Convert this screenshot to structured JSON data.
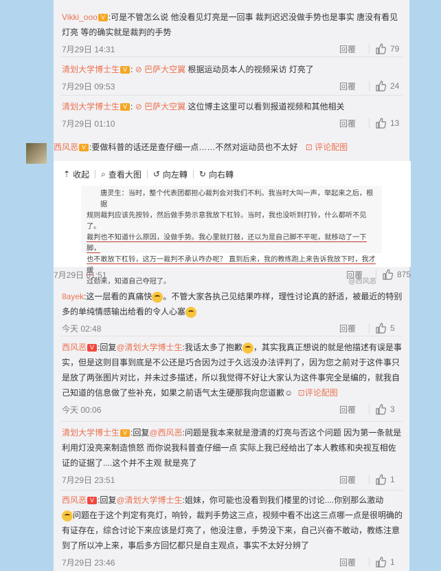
{
  "comments_top": [
    {
      "user": "Vikki_ooo",
      "text": ":可是不管怎么说  他没看见灯亮是一回事  裁判迟迟没做手势也是事实   唐没有看见灯亮  等的确实就是裁判的手势",
      "time": "7月29日 14:31",
      "reply": "回覆",
      "likes": "79"
    },
    {
      "user": "清划大学博士生",
      "link": "巴萨大空翼",
      "text": "根据运动员本人的视频采访 灯亮了",
      "time": "7月29日 09:53",
      "reply": "回覆",
      "likes": "24"
    },
    {
      "user": "清划大学博士生",
      "link": "巴萨大空翼",
      "text": "这位博主这里可以看到报道视频和其他相关",
      "time": "7月29日 01:10",
      "reply": "回覆",
      "likes": "13"
    }
  ],
  "main": {
    "user": "西风恶",
    "text": ":要做科普的话还是查仔细一点……不然对运动员也不太好",
    "pic_link": "评论配图",
    "toolbar": [
      "收起",
      "查看大图",
      "向左轉",
      "向右轉"
    ],
    "quote_lines": [
      "唐灵生：当时，整个代表团都担心裁判会对我们不利。我当时大叫一声，举起来之后，根据",
      "规则裁判应该先按铃，然后做手势示意我放下杠铃。当时，我也没听到打铃，什么都听不见了。",
      "裁判也不知道什么原因，没做手势。我心里就打鼓，还以为是自己脚不平呢，就移动了一下脚，",
      "也不敢放下杠铃，这万一裁判不承认咋办呢？ 直到后来，我的教练跑上来告诉我放下时，我才缓",
      "过劲来，知道自己夺冠了。"
    ],
    "watermark": "@西风恶",
    "time": "7月29日 01:51",
    "reply": "回覆",
    "likes": "875"
  },
  "replies": [
    {
      "user": "8ayek",
      "text": ":这一层看的真痛快",
      "text2": "。不管大家各执己见结果咋样，理性讨论真的舒适，被最近的特别多的单纯情感输出给看的令人心塞",
      "time": "今天 02:48",
      "reply": "回覆",
      "likes": "5"
    },
    {
      "user": "西风恶",
      "prefix": ":回复",
      "mention": "@清划大学博士生",
      "text": ":我话太多了抱歉",
      "text2": "，其实我真正想说的就是他描述有误是事实，但是这则目事到底是不公还是巧合因为过于久远没办法评判了，因为您之前对于这件事只是放了两张图片对比，并未过多描述，所以我觉得不好让大家认为这件事完全是编的，就我自己知道的信息做了些补充，如果之前语气太生硬那我向您道歉",
      "pic_link": "评论配图",
      "time": "今天 00:06",
      "reply": "回覆",
      "likes": "3"
    },
    {
      "user": "清划大学博士生",
      "prefix": ":回复",
      "mention": "@西风恶",
      "text": ":问题是我本来就是澄清的灯亮与否这个问题 因为第一条就是利用灯没亮来制造愤怒 而你说我科普查仔细一点 实际上我已经给出了本人教练和央视互相佐证的证据了....这个并不主观 就是亮了",
      "time": "7月29日 23:51",
      "reply": "回覆",
      "likes": "1"
    },
    {
      "user": "西风恶",
      "prefix": ":回复",
      "mention": "@清划大学博士生",
      "text": ":姐妹，你可能也没看到我们楼里的讨论....你别那么激动",
      "text2": "问题在于这个判定有亮灯，响铃，裁判手势这三点，视频中看不出这三点哪一点是很明确的有证存在，综合讨论下来应该是灯亮了，他没注意，手势没下来，自己兴奋不敢动，教练注意到了所以冲上来，事后多方回忆都只是自主观点，事实不太好分辨了",
      "time": "7月29日 23:46",
      "reply": "回覆",
      "likes": "1"
    }
  ]
}
